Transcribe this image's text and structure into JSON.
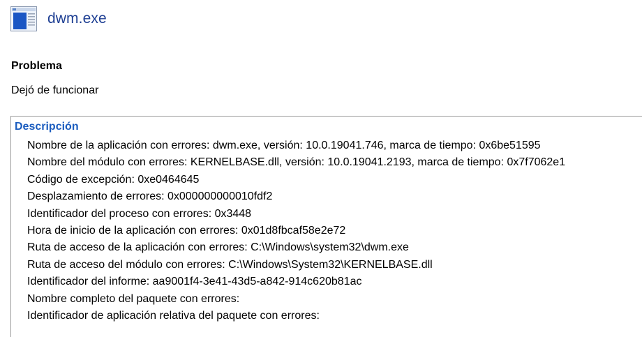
{
  "header": {
    "title": "dwm.exe",
    "icon": "application-window-icon"
  },
  "problem": {
    "heading": "Problema",
    "value": "Dejó de funcionar"
  },
  "description": {
    "heading": "Descripción",
    "lines": [
      "Nombre de la aplicación con errores: dwm.exe, versión: 10.0.19041.746, marca de tiempo: 0x6be51595",
      "Nombre del módulo con errores: KERNELBASE.dll, versión: 10.0.19041.2193, marca de tiempo: 0x7f7062e1",
      "Código de excepción: 0xe0464645",
      "Desplazamiento de errores: 0x000000000010fdf2",
      "Identificador del proceso con errores: 0x3448",
      "Hora de inicio de la aplicación con errores: 0x01d8fbcaf58e2e72",
      "Ruta de acceso de la aplicación con errores: C:\\Windows\\system32\\dwm.exe",
      "Ruta de acceso del módulo con errores: C:\\Windows\\System32\\KERNELBASE.dll",
      "Identificador del informe: aa9001f4-3e41-43d5-a842-914c620b81ac",
      "Nombre completo del paquete con errores:",
      "Identificador de aplicación relativa del paquete con errores:"
    ]
  },
  "colors": {
    "title": "#1e3f93",
    "description_heading": "#1c5dbf",
    "border": "#9a9a9a"
  }
}
